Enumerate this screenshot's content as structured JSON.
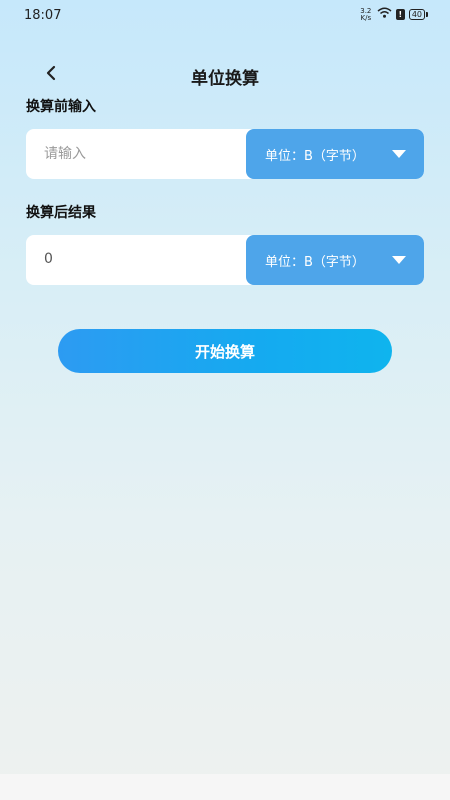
{
  "status_bar": {
    "time": "18:07",
    "net_speed_value": "3.2",
    "net_speed_unit": "K/s",
    "battery": "40",
    "icons": [
      "wifi-icon",
      "alert-icon",
      "battery-icon"
    ]
  },
  "header": {
    "title": "单位换算",
    "back_icon": "chevron-left-icon"
  },
  "input_section": {
    "label": "换算前输入",
    "placeholder": "请输入",
    "unit_label": "单位：B（字节）"
  },
  "output_section": {
    "label": "换算后结果",
    "value": "0",
    "unit_label": "单位：B（字节）"
  },
  "actions": {
    "start_label": "开始换算"
  },
  "colors": {
    "accent": "#4ea5ea",
    "button_gradient_start": "#2d9bf2",
    "button_gradient_end": "#0fb4ee"
  }
}
